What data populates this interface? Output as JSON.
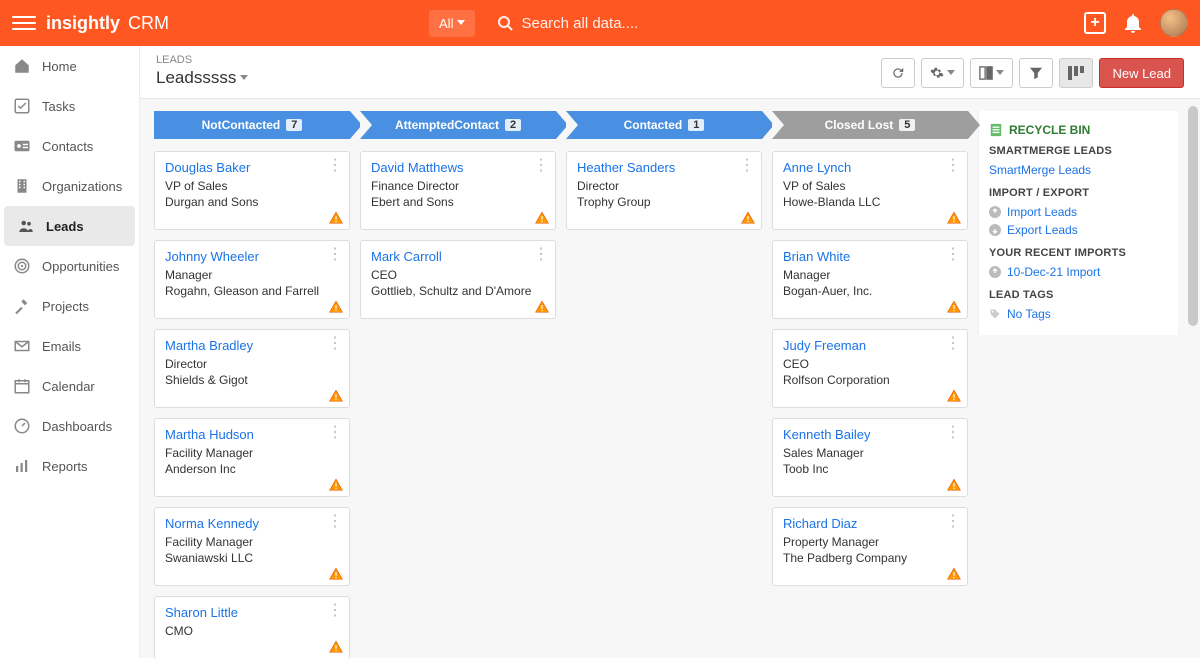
{
  "header": {
    "brand": "insightly",
    "product": "CRM",
    "filter_label": "All",
    "search_placeholder": "Search all data...."
  },
  "nav": {
    "items": [
      {
        "label": "Home",
        "icon": "home"
      },
      {
        "label": "Tasks",
        "icon": "check"
      },
      {
        "label": "Contacts",
        "icon": "badge"
      },
      {
        "label": "Organizations",
        "icon": "building"
      },
      {
        "label": "Leads",
        "icon": "people",
        "active": true
      },
      {
        "label": "Opportunities",
        "icon": "target"
      },
      {
        "label": "Projects",
        "icon": "hammer"
      },
      {
        "label": "Emails",
        "icon": "mail"
      },
      {
        "label": "Calendar",
        "icon": "calendar"
      },
      {
        "label": "Dashboards",
        "icon": "gauge"
      },
      {
        "label": "Reports",
        "icon": "bars"
      }
    ]
  },
  "page": {
    "crumb": "LEADS",
    "view_name": "Leadsssss",
    "new_button": "New Lead"
  },
  "board": {
    "columns": [
      {
        "title": "NotContacted",
        "count": "7",
        "style": "blue",
        "cards": [
          {
            "name": "Douglas Baker",
            "title": "VP of Sales",
            "org": "Durgan and Sons"
          },
          {
            "name": "Johnny Wheeler",
            "title": "Manager",
            "org": "Rogahn, Gleason and Farrell"
          },
          {
            "name": "Martha Bradley",
            "title": "Director",
            "org": "Shields & Gigot"
          },
          {
            "name": "Martha Hudson",
            "title": "Facility Manager",
            "org": "Anderson Inc"
          },
          {
            "name": "Norma Kennedy",
            "title": "Facility Manager",
            "org": "Swaniawski LLC"
          },
          {
            "name": "Sharon Little",
            "title": "CMO",
            "org": ""
          }
        ]
      },
      {
        "title": "AttemptedContact",
        "count": "2",
        "style": "blue",
        "cards": [
          {
            "name": "David Matthews",
            "title": "Finance Director",
            "org": "Ebert and Sons"
          },
          {
            "name": "Mark Carroll",
            "title": "CEO",
            "org": "Gottlieb, Schultz and D'Amore"
          }
        ]
      },
      {
        "title": "Contacted",
        "count": "1",
        "style": "blue",
        "cards": [
          {
            "name": "Heather Sanders",
            "title": "Director",
            "org": "Trophy Group"
          }
        ]
      },
      {
        "title": "Closed Lost",
        "count": "5",
        "style": "grey",
        "cards": [
          {
            "name": "Anne Lynch",
            "title": "VP of Sales",
            "org": "Howe-Blanda LLC"
          },
          {
            "name": "Brian White",
            "title": "Manager",
            "org": "Bogan-Auer, Inc."
          },
          {
            "name": "Judy Freeman",
            "title": "CEO",
            "org": "Rolfson Corporation"
          },
          {
            "name": "Kenneth Bailey",
            "title": "Sales Manager",
            "org": "Toob Inc"
          },
          {
            "name": "Richard Diaz",
            "title": "Property Manager",
            "org": "The Padberg Company"
          }
        ]
      }
    ]
  },
  "right": {
    "recycle": "RECYCLE BIN",
    "sm_title": "SMARTMERGE LEADS",
    "sm_link": "SmartMerge Leads",
    "ie_title": "IMPORT / EXPORT",
    "import_link": "Import Leads",
    "export_link": "Export Leads",
    "recent_title": "YOUR RECENT IMPORTS",
    "recent_link": "10-Dec-21 Import",
    "tags_title": "LEAD TAGS",
    "no_tags": "No Tags"
  }
}
